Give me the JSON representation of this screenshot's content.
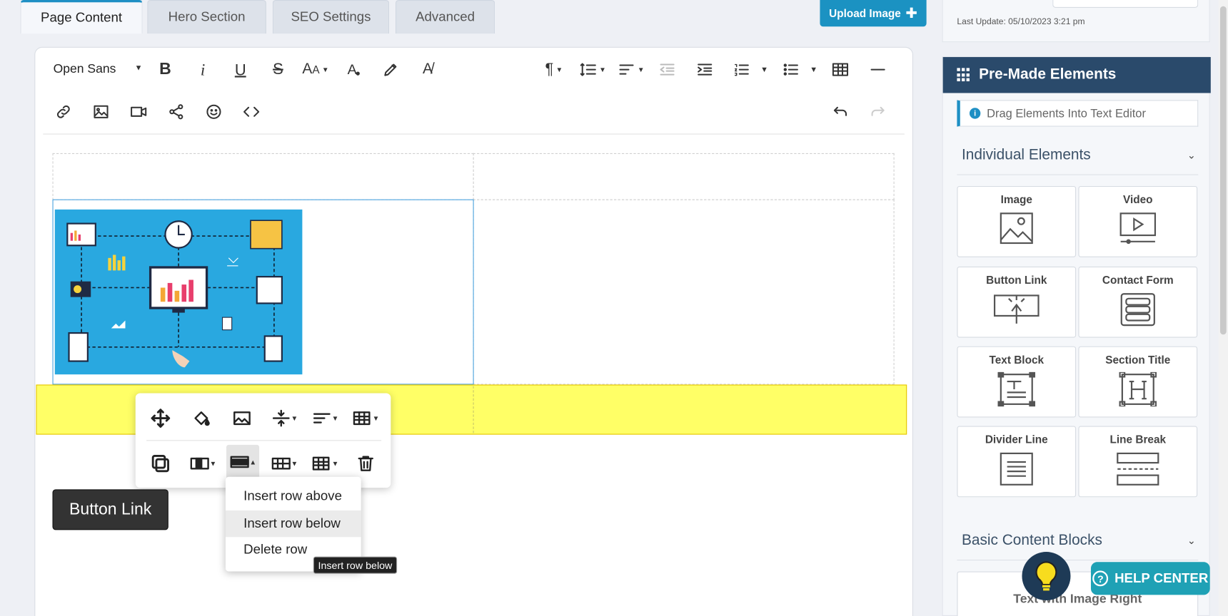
{
  "tabs": [
    "Page Content",
    "Hero Section",
    "SEO Settings",
    "Advanced"
  ],
  "upload_button": "Upload Image",
  "last_update": "Last Update: 05/10/2023 3:21 pm",
  "toolbar": {
    "font_family": "Open Sans"
  },
  "popup_menu": {
    "items": [
      "Insert row above",
      "Insert row below",
      "Delete row"
    ],
    "highlighted": "Insert row below"
  },
  "tooltip": "Insert row below",
  "button_link_label": "Button Link",
  "sidebar": {
    "pre_made_title": "Pre-Made Elements",
    "drag_hint": "Drag Elements Into Text Editor",
    "individual_title": "Individual Elements",
    "elements": [
      {
        "label": "Image",
        "icon": "image-icon"
      },
      {
        "label": "Video",
        "icon": "video-icon"
      },
      {
        "label": "Button Link",
        "icon": "button-link-icon"
      },
      {
        "label": "Contact Form",
        "icon": "contact-form-icon"
      },
      {
        "label": "Text Block",
        "icon": "text-block-icon"
      },
      {
        "label": "Section Title",
        "icon": "section-title-icon"
      },
      {
        "label": "Divider Line",
        "icon": "divider-line-icon"
      },
      {
        "label": "Line Break",
        "icon": "line-break-icon"
      }
    ],
    "basic_title": "Basic Content Blocks",
    "basic_first": "Text with Image Right"
  },
  "help_center": "HELP CENTER",
  "colors": {
    "accent": "#1b92c2",
    "sidebar_header": "#2a4a6b",
    "highlight_row": "#ffff66",
    "help": "#1fa1b5"
  }
}
